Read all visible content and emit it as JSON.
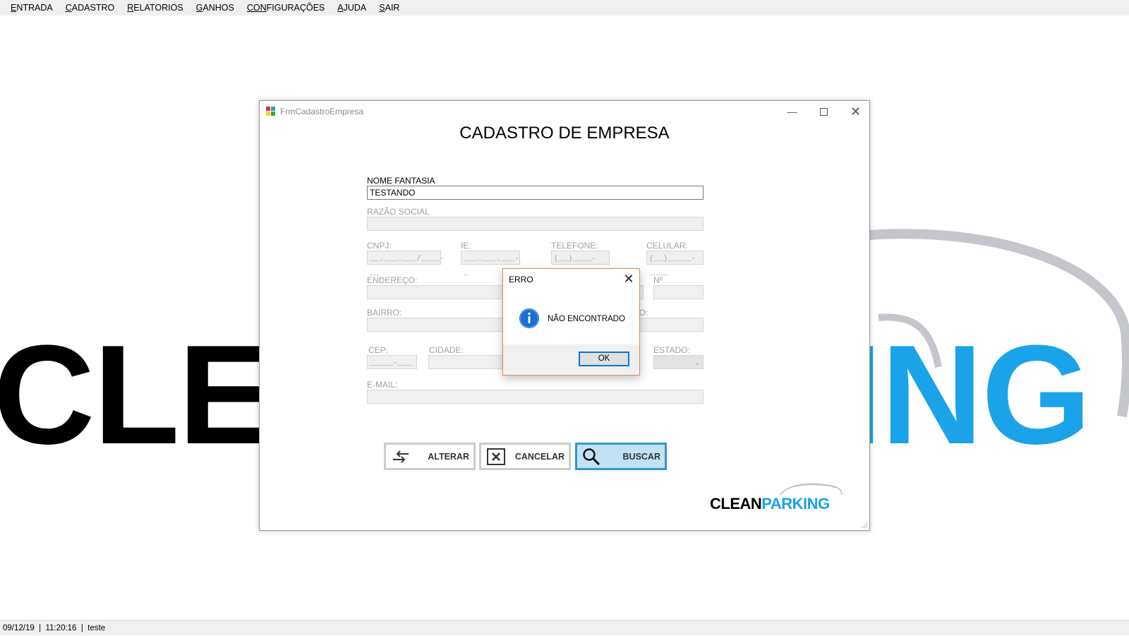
{
  "menu": {
    "items": [
      {
        "u": "E",
        "rest": "NTRADA"
      },
      {
        "u": "C",
        "rest": "ADASTRO"
      },
      {
        "u": "R",
        "rest": "ELATORIOS"
      },
      {
        "u": "G",
        "rest": "ANHOS"
      },
      {
        "u": "CON",
        "pre": "",
        "rest": "FIGURAÇÕES"
      },
      {
        "u": "A",
        "rest": "JUDA"
      },
      {
        "u": "S",
        "rest": "AIR"
      }
    ]
  },
  "background": {
    "left_text": "CLE",
    "right_text": "ING"
  },
  "window": {
    "title": "FrmCadastroEmpresa",
    "form_title": "CADASTRO DE EMPRESA",
    "fields": {
      "nome_fantasia": {
        "label": "NOME FANTASIA",
        "value": "TESTANDO"
      },
      "razao_social": {
        "label": "RAZÃO SOCIAL",
        "value": ""
      },
      "cnpj": {
        "label": "CNPJ:",
        "mask": "__.___.___/____-__"
      },
      "ie": {
        "label": "IE:",
        "mask": "___.___.___-_"
      },
      "telefone": {
        "label": "TELEFONE:",
        "mask": "(__)____-____"
      },
      "celular": {
        "label": "CELULAR:",
        "mask": "(__)_____-____"
      },
      "endereco": {
        "label": "ENDEREÇO:",
        "value": ""
      },
      "numero": {
        "label": "Nº",
        "value": ""
      },
      "bairro": {
        "label": "BAIRRO:",
        "value": ""
      },
      "complemento_partial": {
        "label": "NTO:",
        "value": ""
      },
      "cep": {
        "label": "CEP:",
        "mask": "_____-___"
      },
      "cidade": {
        "label": "CIDADE:",
        "value": ""
      },
      "estado": {
        "label": "ESTADO:",
        "value": ""
      },
      "email": {
        "label": "E-MAIL:",
        "value": ""
      }
    },
    "buttons": {
      "alterar": "ALTERAR",
      "cancelar": "CANCELAR",
      "buscar": "BUSCAR"
    },
    "logo": {
      "part1": "CLEAN",
      "part2": "PARKING"
    }
  },
  "dialog": {
    "title": "ERRO",
    "message": "NÃO ENCONTRADO",
    "ok_label": "OK"
  },
  "status": {
    "date": "09/12/19",
    "time": "11:20:16",
    "user": "teste"
  },
  "colors": {
    "brand_blue": "#1aa3e8",
    "accent_border": "#3398cc",
    "dialog_border": "#e28a4a"
  }
}
